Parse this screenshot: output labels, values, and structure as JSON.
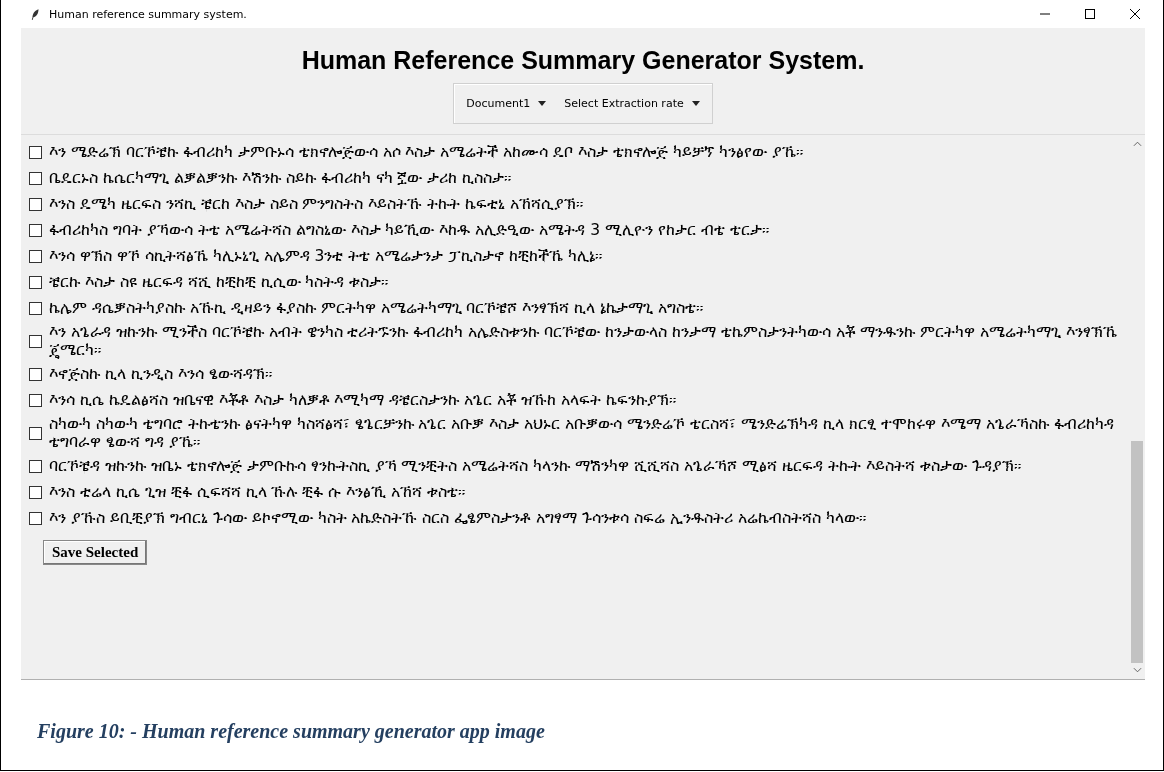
{
  "window": {
    "title": "Human reference summary system."
  },
  "heading": "Human Reference Summary Generator System.",
  "dropdowns": [
    {
      "value": "Document1"
    },
    {
      "value": "Select Extraction rate"
    }
  ],
  "sentences": [
    {
      "text": "እን ሜድሬኽ ባርኾቼኩ ፋብሪከካ ታምቡኑሳ ቴክኖሎጅውሳ አሶ እስታ አሜሬትች አከሙሳ ዴቦ እስታ ቴክኖሎጅ ካይቻኘ ካንፅየው ያኼ።",
      "checked": false
    },
    {
      "text": "ቤዴርኑስ ኬሴርካማጊ ልቓልቓንኩ እሽንኩ ስይኩ ፋብሪከካ ናካ ኟው ታሪከ ኪስስታ።",
      "checked": false
    },
    {
      "text": "እንስ ዴሜካ ዜርፍስ ንሻኪ ቼርከ እስታ ስይስ ምንግስትስ እይስትኹ ትኩት ኬፍቲኒ አኸሻሲያኽ።",
      "checked": false
    },
    {
      "text": "ፋብሪከካስ ግባት ያኻውሳ ትቴ አሜሬትሻስ ልግስኒው እስታ ካይኺው እከዱ አሊድዒው አሜትዳ 3 ሚሊዮን የከታር ብቴ ቴርታ።",
      "checked": false
    },
    {
      "text": "እንሳ ዋኽስ ዋኾ ሳኪትሻፅኼ ካሊኑኒጊ አሌምዳ 3ንቲ ትቴ አሜሬታንታ ፓኪስታኖ ከቺከችኼ ካሊኔ።",
      "checked": false
    },
    {
      "text": "ቼርኩ እስታ ስዩ ዜርፍዳ ሻሺ ከቺከቺ ኪሲው ካስትዳ ቱስታ።",
      "checked": false
    },
    {
      "text": "ኬሌም ዳሴቓስትካያስኩ አኹኪ ዲዛይን ፋያስኩ ምርትካዋ አሜሬትካማጊ ባርኾቼሾ እንፃኽሻ ኪላ ኔኬታማጊ አግስቴ።",
      "checked": false
    },
    {
      "text": "እን አጌራዳ ዝኩንኩ ሚንችስ ባርኾቼኩ አብት ዌንካስ ቲሪትኙንኩ ፋብሪከካ አሌድስቱንኩ ባርኾቼው ከንታውላስ ከንታማ ቴኬምስታንትካውሳ አቾ ማንዱንኩ ምርትካዋ አሜሬትካማጊ እንፃኽኼ ጄሜርካ።",
      "checked": false
    },
    {
      "text": "እኖጅስኩ ኪላ ኪንዲስ እንሳ ፄውሻዳኽ።",
      "checked": false
    },
    {
      "text": "እንሳ ኪሴ ኬዴልፅሻስ ዝቤናዊ እቾቶ እስታ ካለቓቶ እሚካማ ዳቼርስታንኩ አጌር አቾ ዝኹከ አላፍት ኬፍንኩያኽ።",
      "checked": false
    },
    {
      "text": "ስካውካ ስካውካ ቴግባሮ ትኩቴንኩ ፅናትካዋ ካስሻፅሻ፣ ፄጌርቻንኩ አጌር አቡቓ እስታ አህኑር አቡቓውሳ ሜንድሬኾ ቴርስሻ፣ ሜንድሬኽካዳ ኪላ ክርፂ ተሞከሩዋ እሜማ አጌራኻስኩ ፋብሪከካዳ ቴግባራዋ ፄውሻ ግዳ ያኼ።",
      "checked": false
    },
    {
      "text": "ባርኾቼዳ ዝኩንኩ ዝቤኑ ቴክኖሎጅ ታምቡኩሳ ፃንኩትስኪ ያኻ ሚንቺትስ አሜሬትሻስ ካላንኩ ማሽንካዋ ሺሺሻስ አጌራኻሾ ሚፅሻ ዜርፍዳ ትኩት እይስትሻ ቱስታው ጉዳያኽ።",
      "checked": false
    },
    {
      "text": "እንስ ቲሬላ ኪሴ ጊዝ ቺፋ ሲፍሻሻ ኪላ ኹሉ ቺፋ ሱ እንፅኺ አኸሻ ቱስቴ።",
      "checked": false
    },
    {
      "text": "እን ያኹስ ይቢቺያኽ ግብርኒ ጉሳው ይኮኖሚው ካስት አኬድስትኹ ስርስ ፌፄምስታንቶ አግፃማ ጉሳንቱሳ ስፍሬ ኢንዱስትሪ አሬኬብስትሻስ ካላው።",
      "checked": false
    }
  ],
  "buttons": [
    {
      "label": "Save Selected"
    }
  ],
  "caption": "Figure 10: - Human reference summary generator app image"
}
